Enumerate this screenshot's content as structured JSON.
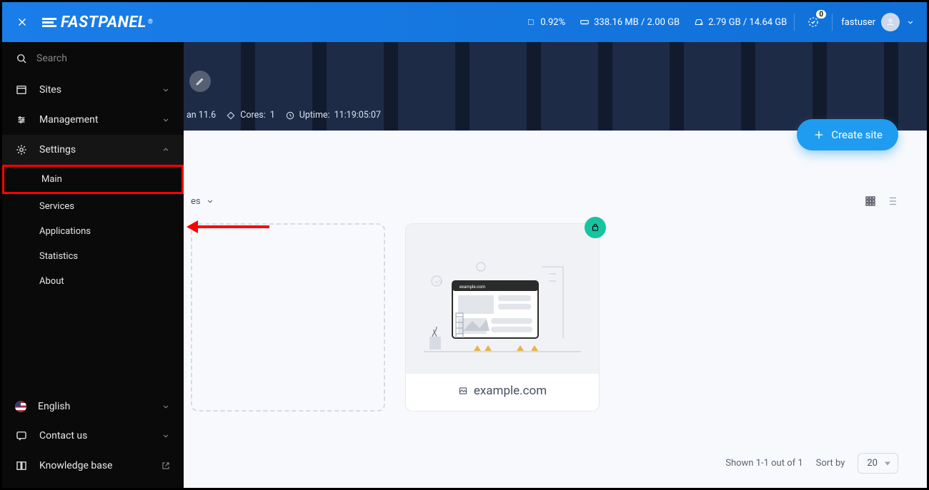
{
  "header": {
    "logo": "FASTPANEL",
    "cpu_pct": "0.92%",
    "ram": "338.16 MB / 2.00 GB",
    "disk": "2.79 GB / 14.64 GB",
    "tasks_count": "0",
    "username": "fastuser"
  },
  "sidebar": {
    "search_placeholder": "Search",
    "items": {
      "sites": "Sites",
      "management": "Management",
      "settings": "Settings"
    },
    "settings_children": {
      "main": "Main",
      "services": "Services",
      "applications": "Applications",
      "statistics": "Statistics",
      "about": "About"
    },
    "bottom": {
      "language": "English",
      "contact": "Contact us",
      "kb": "Knowledge base"
    }
  },
  "banner": {
    "os": "an 11.6",
    "cores_label": "Cores:",
    "cores": "1",
    "uptime_label": "Uptime:",
    "uptime": "11:19:05:07"
  },
  "actions": {
    "create_site": "Create site"
  },
  "toolbar": {
    "visible_suffix": "es"
  },
  "cards": {
    "site_domain": "example.com"
  },
  "pager": {
    "shown": "Shown 1-1 out of 1",
    "sort_label": "Sort by",
    "per_page": "20"
  }
}
